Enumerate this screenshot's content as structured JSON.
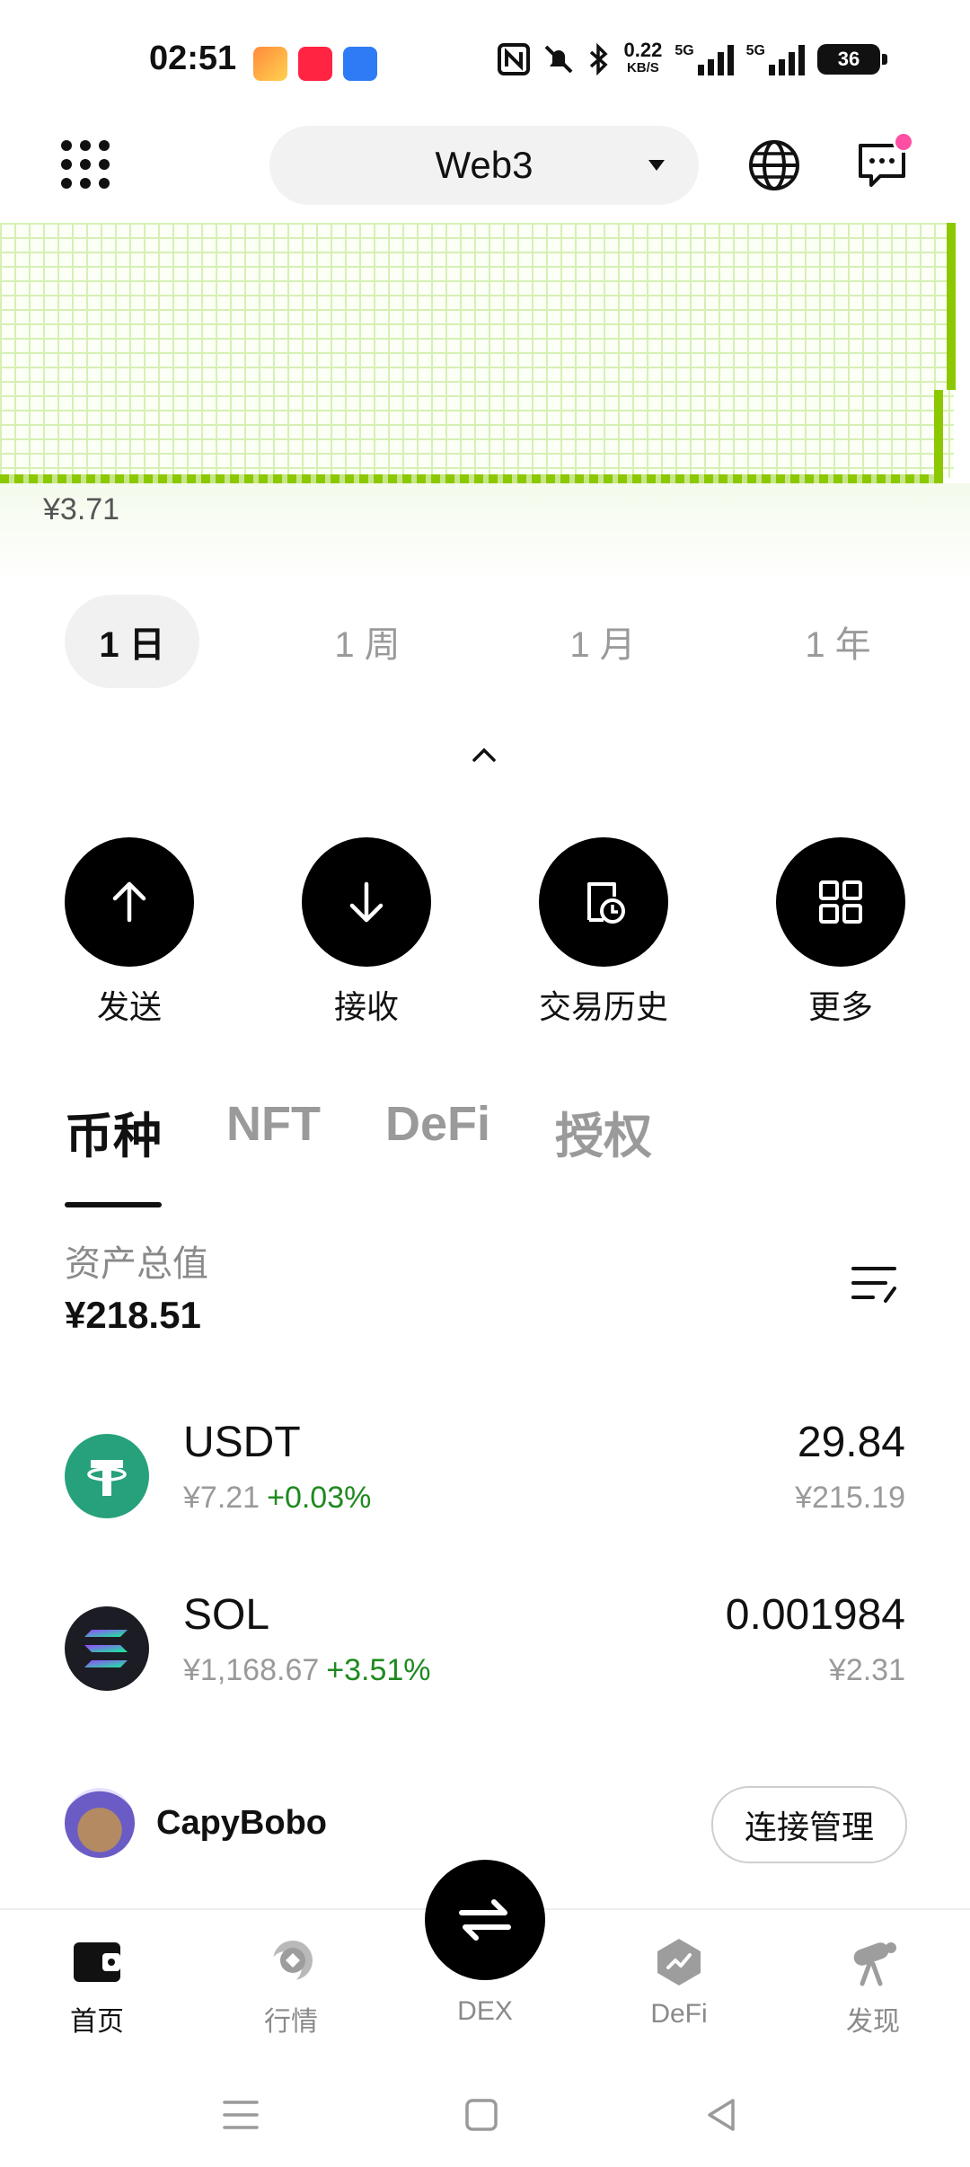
{
  "status_bar": {
    "time": "02:51",
    "net_speed_value": "0.22",
    "net_speed_unit": "KB/S",
    "signal1_label": "5G",
    "signal2_label": "5G",
    "battery": "36",
    "icons": [
      "game-app-icon",
      "xiaohongshu-app-icon",
      "blue-app-icon",
      "nfc-icon",
      "mute-icon",
      "bluetooth-icon"
    ]
  },
  "header": {
    "network_label": "Web3"
  },
  "chart": {
    "low_price_label": "¥3.71"
  },
  "periods": [
    {
      "label": "1 日",
      "active": true
    },
    {
      "label": "1 周",
      "active": false
    },
    {
      "label": "1 月",
      "active": false
    },
    {
      "label": "1 年",
      "active": false
    }
  ],
  "actions": [
    {
      "label": "发送",
      "icon": "arrow-up-icon"
    },
    {
      "label": "接收",
      "icon": "arrow-down-icon"
    },
    {
      "label": "交易历史",
      "icon": "history-icon"
    },
    {
      "label": "更多",
      "icon": "grid-icon"
    }
  ],
  "asset_tabs": [
    {
      "label": "币种",
      "active": true
    },
    {
      "label": "NFT",
      "active": false
    },
    {
      "label": "DeFi",
      "active": false
    },
    {
      "label": "授权",
      "active": false
    }
  ],
  "total": {
    "label": "资产总值",
    "value": "¥218.51"
  },
  "tokens": [
    {
      "symbol": "USDT",
      "price": "¥7.21",
      "change": "+0.03%",
      "amount": "29.84",
      "value": "¥215.19"
    },
    {
      "symbol": "SOL",
      "price": "¥1,168.67",
      "change": "+3.51%",
      "amount": "0.001984",
      "value": "¥2.31"
    }
  ],
  "account": {
    "name": "CapyBobo",
    "connect_label": "连接管理"
  },
  "bottom_nav": [
    {
      "label": "首页",
      "icon": "wallet-icon",
      "active": true
    },
    {
      "label": "行情",
      "icon": "market-icon",
      "active": false
    },
    {
      "label": "DEX",
      "icon": "swap-icon",
      "active": false
    },
    {
      "label": "DeFi",
      "icon": "defi-icon",
      "active": false
    },
    {
      "label": "发现",
      "icon": "discover-icon",
      "active": false
    }
  ],
  "colors": {
    "chart_green": "#8cc800",
    "positive": "#1f8a1f",
    "notification_dot": "#ff4fa3",
    "usdt": "#26a17b"
  }
}
